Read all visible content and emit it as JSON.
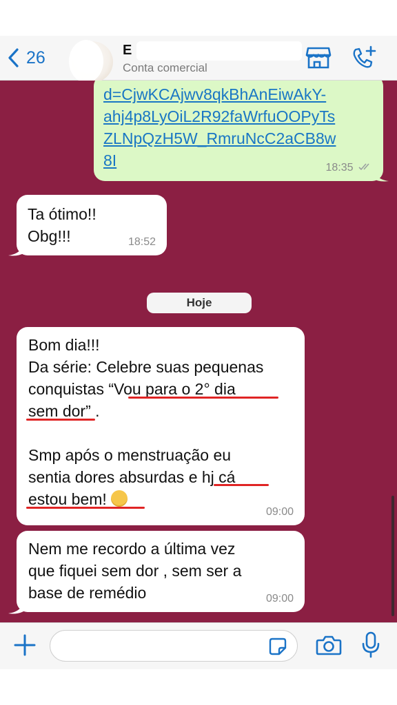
{
  "header": {
    "back_count": "26",
    "contact_name": "E",
    "contact_subtitle": "Conta comercial"
  },
  "messages": {
    "link_message": {
      "lines": [
        "d=CjwKCAjwv8qkBhAnEiwAkY-",
        "ahj4p8LyOiL2R92faWrfuOOPyTs",
        "ZLNpQzH5W_RmruNcC2aCB8w",
        "8I"
      ],
      "time": "18:35"
    },
    "msg_ok": {
      "line1": "Ta ótimo!!",
      "line2": "Obg!!!",
      "time": "18:52"
    },
    "date_separator": "Hoje",
    "msg_bom_dia": {
      "line1": "Bom dia!!!",
      "line2": "Da série: Celebre suas pequenas",
      "line3": "conquistas “Vou para o 2° dia",
      "line4": "sem dor” .",
      "line5": "Smp após o menstruação eu",
      "line6": "sentia dores absurdas e hj cá",
      "line7": "estou bem!",
      "time": "09:00"
    },
    "msg_nem": {
      "line1": "Nem me recordo a última vez",
      "line2": "que fiquei sem dor , sem ser a",
      "line3": "base de remédio",
      "time": "09:00"
    }
  },
  "composer": {
    "placeholder": ""
  },
  "colors": {
    "chat_background": "#8b1f43",
    "outgoing_bubble": "#dcf8c6",
    "incoming_bubble": "#ffffff",
    "accent": "#1a73c7",
    "link": "#1976c4",
    "highlight_underline": "#e02424"
  },
  "icons": {
    "back": "chevron-left-icon",
    "store": "store-icon",
    "call": "phone-plus-icon",
    "attach": "plus-icon",
    "sticker": "sticker-icon",
    "camera": "camera-icon",
    "mic": "microphone-icon",
    "read_receipt": "double-check-icon",
    "emoji": "pleading-face-emoji"
  }
}
